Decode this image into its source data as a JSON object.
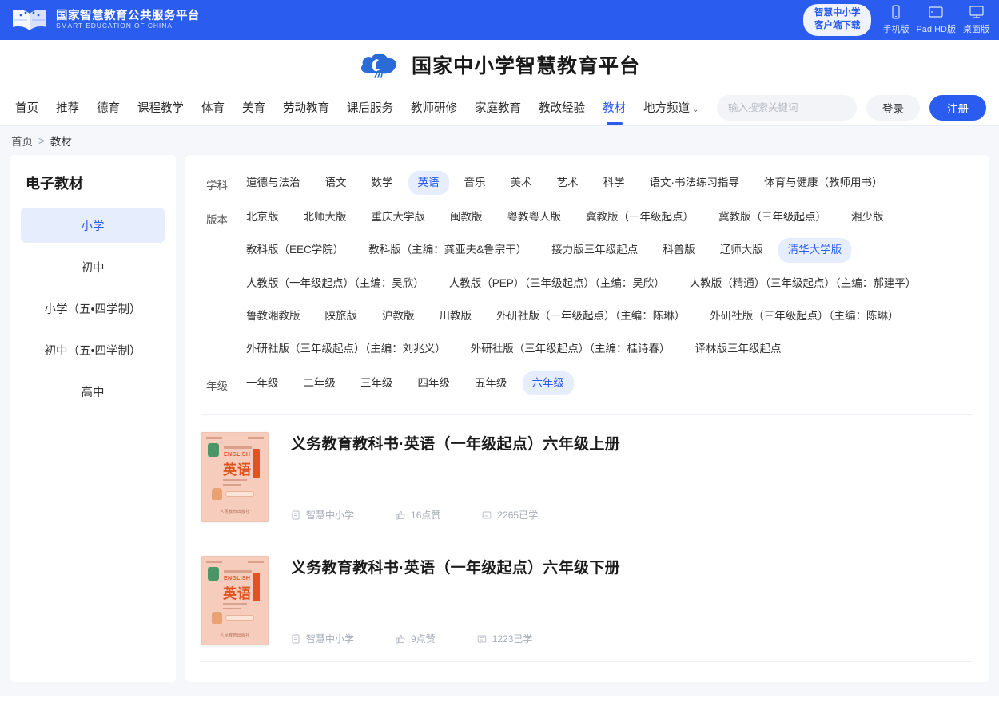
{
  "topbar": {
    "gov_cn": "国家智慧教育公共服务平台",
    "gov_en": "SMART EDUCATION OF CHINA",
    "client_line1": "智慧中小学",
    "client_line2": "客户端下载",
    "devices": [
      {
        "label": "手机版",
        "icon": "phone-icon"
      },
      {
        "label": "Pad HD版",
        "icon": "tablet-icon"
      },
      {
        "label": "桌面版",
        "icon": "desktop-icon"
      }
    ]
  },
  "brand": {
    "title": "国家中小学智慧教育平台",
    "logo": "cloud-logo-icon"
  },
  "nav": {
    "items": [
      {
        "label": "首页",
        "active": false
      },
      {
        "label": "推荐",
        "active": false
      },
      {
        "label": "德育",
        "active": false
      },
      {
        "label": "课程教学",
        "active": false
      },
      {
        "label": "体育",
        "active": false
      },
      {
        "label": "美育",
        "active": false
      },
      {
        "label": "劳动教育",
        "active": false
      },
      {
        "label": "课后服务",
        "active": false
      },
      {
        "label": "教师研修",
        "active": false
      },
      {
        "label": "家庭教育",
        "active": false
      },
      {
        "label": "教改经验",
        "active": false
      },
      {
        "label": "教材",
        "active": true
      },
      {
        "label": "地方频道",
        "active": false,
        "caret": true
      }
    ],
    "caret_glyph": "⌄"
  },
  "search": {
    "placeholder": "输入搜索关键词",
    "value": "",
    "icon": "search-icon"
  },
  "auth": {
    "login_label": "登录",
    "register_label": "注册"
  },
  "breadcrumb": {
    "home": "首页",
    "separator": ">",
    "current": "教材"
  },
  "sidebar": {
    "title": "电子教材",
    "items": [
      {
        "label": "小学",
        "active": true
      },
      {
        "label": "初中",
        "active": false
      },
      {
        "label": "小学（五•四学制）",
        "active": false
      },
      {
        "label": "初中（五•四学制）",
        "active": false
      },
      {
        "label": "高中",
        "active": false
      }
    ]
  },
  "filters": [
    {
      "label": "学科",
      "options": [
        {
          "label": "道德与法治",
          "active": false
        },
        {
          "label": "语文",
          "active": false
        },
        {
          "label": "数学",
          "active": false
        },
        {
          "label": "英语",
          "active": true
        },
        {
          "label": "音乐",
          "active": false
        },
        {
          "label": "美术",
          "active": false
        },
        {
          "label": "艺术",
          "active": false
        },
        {
          "label": "科学",
          "active": false
        },
        {
          "label": "语文·书法练习指导",
          "active": false
        },
        {
          "label": "体育与健康（教师用书）",
          "active": false
        }
      ]
    },
    {
      "label": "版本",
      "options": [
        {
          "label": "北京版",
          "active": false
        },
        {
          "label": "北师大版",
          "active": false
        },
        {
          "label": "重庆大学版",
          "active": false
        },
        {
          "label": "闽教版",
          "active": false
        },
        {
          "label": "粤教粤人版",
          "active": false
        },
        {
          "label": "冀教版（一年级起点）",
          "active": false
        },
        {
          "label": "冀教版（三年级起点）",
          "active": false
        },
        {
          "label": "湘少版",
          "active": false
        },
        {
          "label": "教科版（EEC学院）",
          "active": false
        },
        {
          "label": "教科版（主编：龚亚夫&鲁宗干）",
          "active": false
        },
        {
          "label": "接力版三年级起点",
          "active": false
        },
        {
          "label": "科普版",
          "active": false
        },
        {
          "label": "辽师大版",
          "active": false
        },
        {
          "label": "清华大学版",
          "active": true
        },
        {
          "label": "人教版（一年级起点）（主编：吴欣）",
          "active": false
        },
        {
          "label": "人教版（PEP）（三年级起点）（主编：吴欣）",
          "active": false
        },
        {
          "label": "人教版（精通）（三年级起点）（主编：郝建平）",
          "active": false
        },
        {
          "label": "鲁教湘教版",
          "active": false
        },
        {
          "label": "陕旅版",
          "active": false
        },
        {
          "label": "沪教版",
          "active": false
        },
        {
          "label": "川教版",
          "active": false
        },
        {
          "label": "外研社版（一年级起点）（主编：陈琳）",
          "active": false
        },
        {
          "label": "外研社版（三年级起点）（主编：陈琳）",
          "active": false
        },
        {
          "label": "外研社版（三年级起点）（主编：刘兆义）",
          "active": false
        },
        {
          "label": "外研社版（三年级起点）（主编：桂诗春）",
          "active": false
        },
        {
          "label": "译林版三年级起点",
          "active": false
        }
      ]
    },
    {
      "label": "年级",
      "options": [
        {
          "label": "一年级",
          "active": false
        },
        {
          "label": "二年级",
          "active": false
        },
        {
          "label": "三年级",
          "active": false
        },
        {
          "label": "四年级",
          "active": false
        },
        {
          "label": "五年级",
          "active": false
        },
        {
          "label": "六年级",
          "active": true
        }
      ]
    }
  ],
  "books": [
    {
      "title": "义务教育教科书·英语（一年级起点）六年级上册",
      "publisher": "智慧中小学",
      "likes": "16点赞",
      "learned": "2265已学",
      "cover": {
        "english": "ENGLISH",
        "chinese": "英语",
        "footer": "人民教育出版社"
      }
    },
    {
      "title": "义务教育教科书·英语（一年级起点）六年级下册",
      "publisher": "智慧中小学",
      "likes": "9点赞",
      "learned": "1223已学",
      "cover": {
        "english": "ENGLISH",
        "chinese": "英语",
        "footer": "人民教育出版社"
      }
    }
  ],
  "icons": {
    "publisher": "book-icon",
    "likes": "thumbs-up-icon",
    "learned": "study-icon"
  },
  "colors": {
    "brand_blue": "#2a5cf0",
    "chip_active_bg": "#e6edfd",
    "page_bg": "#f5f7fb"
  }
}
